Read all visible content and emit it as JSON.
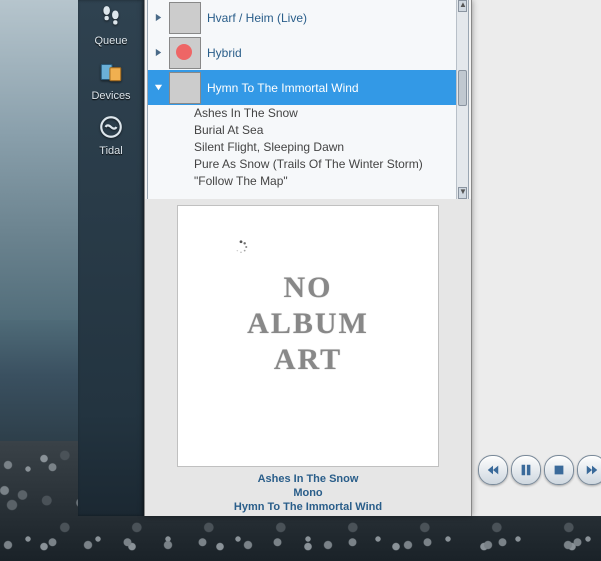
{
  "sidebar": {
    "items": [
      {
        "label": "Queue",
        "icon": "footprints-icon"
      },
      {
        "label": "Devices",
        "icon": "devices-icon"
      },
      {
        "label": "Tidal",
        "icon": "tidal-icon"
      }
    ]
  },
  "albums": [
    {
      "title": "Hvarf / Heim (Live)",
      "expanded": false,
      "selected": false
    },
    {
      "title": "Hybrid",
      "expanded": false,
      "selected": false
    },
    {
      "title": "Hymn To The Immortal Wind",
      "expanded": true,
      "selected": true,
      "tracks": [
        "Ashes In The Snow",
        "Burial At Sea",
        "Silent Flight, Sleeping Dawn",
        "Pure As Snow (Trails Of The Winter Storm)",
        "\"Follow The Map\""
      ]
    }
  ],
  "noart": {
    "line1": "NO",
    "line2": "ALBUM",
    "line3": "ART"
  },
  "nowplaying": {
    "track": "Ashes In The Snow",
    "artist": "Mono",
    "album": "Hymn To The Immortal Wind"
  },
  "player": {
    "prev": "previous-button",
    "pause": "pause-button",
    "stop": "stop-button",
    "next": "next-button"
  }
}
